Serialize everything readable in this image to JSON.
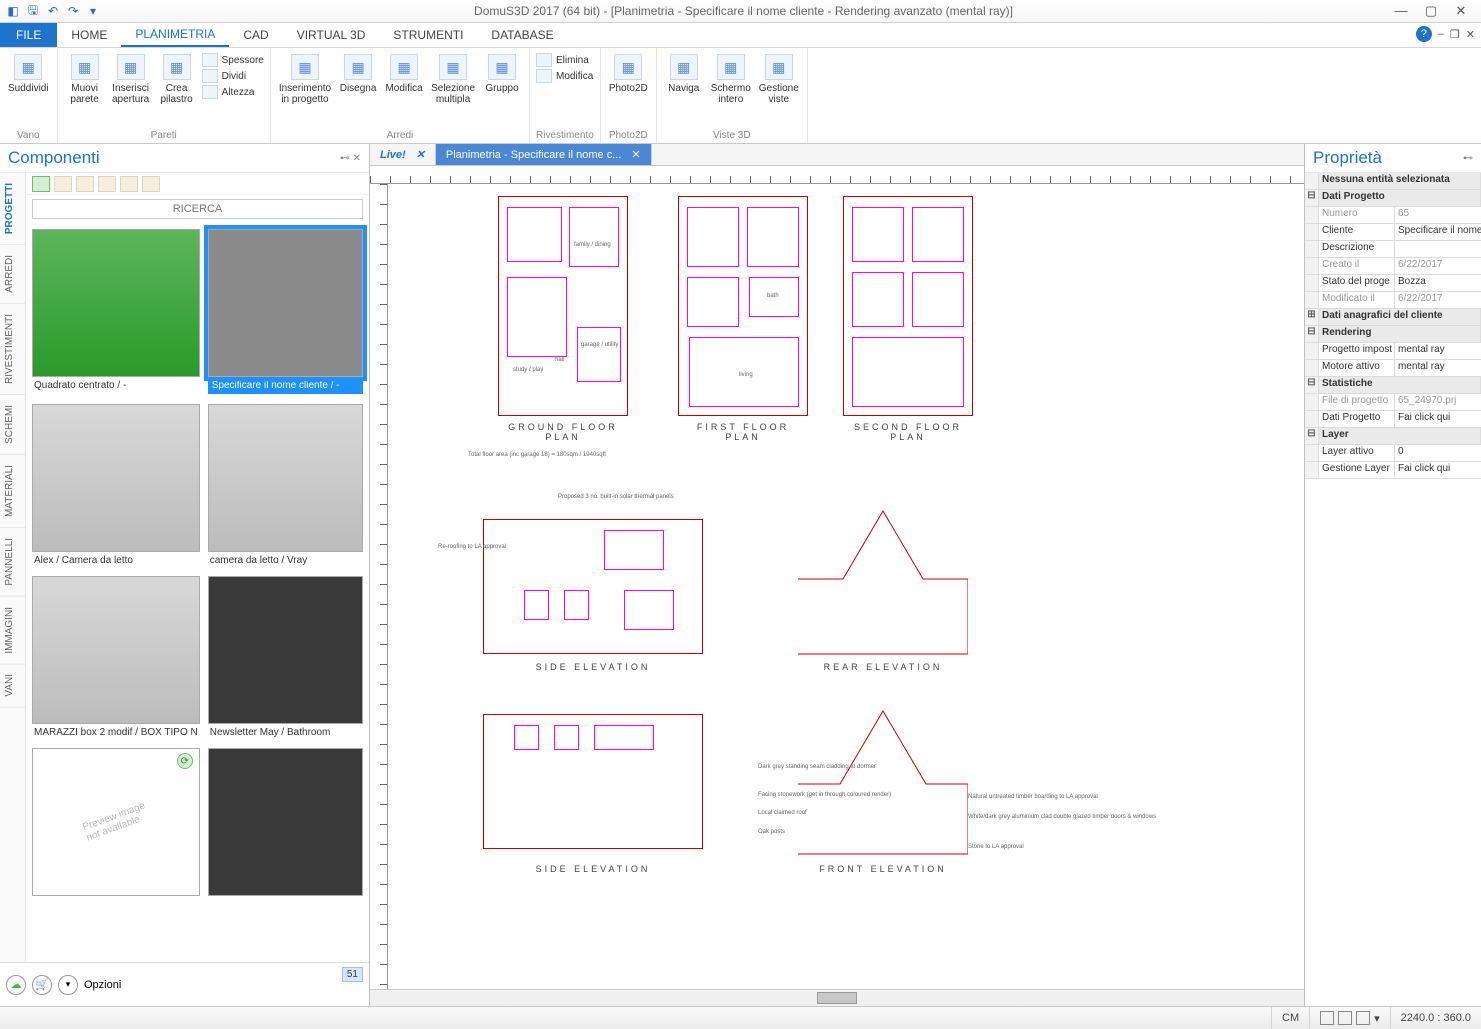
{
  "title": "DomuS3D 2017 (64 bit) - [Planimetria - Specificare il nome cliente - Rendering avanzato (mental ray)]",
  "menu": {
    "file": "FILE",
    "tabs": [
      "HOME",
      "PLANIMETRIA",
      "CAD",
      "VIRTUAL 3D",
      "STRUMENTI",
      "DATABASE"
    ],
    "active": 1
  },
  "ribbon": {
    "groups": [
      {
        "label": "Vano",
        "items": [
          {
            "label": "Suddividi"
          }
        ]
      },
      {
        "label": "Pareti",
        "items": [
          {
            "label": "Muovi\nparete"
          },
          {
            "label": "Inserisci\napertura"
          },
          {
            "label": "Crea\npilastro"
          }
        ],
        "stack": [
          "Spessore",
          "Dividi",
          "Altezza"
        ]
      },
      {
        "label": "Arredi",
        "items": [
          {
            "label": "Inserimento\nin progetto"
          },
          {
            "label": "Disegna"
          },
          {
            "label": "Modifica"
          },
          {
            "label": "Selezione\nmultipla"
          },
          {
            "label": "Gruppo"
          }
        ]
      },
      {
        "label": "Rivestimento",
        "items": [],
        "stack": [
          "Elimina",
          "Modifica"
        ]
      },
      {
        "label": "Photo2D",
        "items": [
          {
            "label": "Photo2D"
          }
        ]
      },
      {
        "label": "Viste 3D",
        "items": [
          {
            "label": "Naviga"
          },
          {
            "label": "Schermo\nintero"
          },
          {
            "label": "Gestione\nviste"
          }
        ]
      }
    ]
  },
  "componenti": {
    "title": "Componenti",
    "search_placeholder": "RICERCA",
    "vtabs": [
      "PROGETTI",
      "ARREDI",
      "RIVESTIMENTI",
      "SCHEMI",
      "MATERIALI",
      "PANNELLI",
      "IMMAGINI",
      "VANI"
    ],
    "vtab_active": 0,
    "thumbs": [
      {
        "cap": "Quadrato centrato / -",
        "cls": "green"
      },
      {
        "cap": "Specificare il nome cliente / -",
        "cls": "gray",
        "selected": true
      },
      {
        "cap": "Alex / Camera da letto",
        "cls": "room"
      },
      {
        "cap": "camera da letto / Vray",
        "cls": "room"
      },
      {
        "cap": "MARAZZI box 2 modif / BOX TIPO N",
        "cls": "room"
      },
      {
        "cap": "Newsletter May / Bathroom",
        "cls": "dark"
      },
      {
        "cap": "",
        "cls": "noprev",
        "noprev": true
      },
      {
        "cap": "",
        "cls": "dark"
      }
    ],
    "counter": "51",
    "opzioni": "Opzioni"
  },
  "doctabs": {
    "live": "Live!",
    "active": "Planimetria - Specificare il nome c..."
  },
  "canvas_labels": {
    "ground": "GROUND FLOOR PLAN",
    "first": "FIRST FLOOR PLAN",
    "second": "SECOND FLOOR PLAN",
    "side1": "SIDE ELEVATION",
    "rear": "REAR ELEVATION",
    "side2": "SIDE ELEVATION",
    "front": "FRONT ELEVATION",
    "note_area": "Total floor area (inc garage 18) = 180sqm / 1940sqft",
    "note_panels": "Proposed 3 no. built-in solar thermal panels",
    "note_roofing": "Re-roofing to LA approval",
    "note_cladding": "Dark grey standing seam cladding to dormer",
    "note_facing": "Facing stonework (get in through coloured render)",
    "note_reclaimed": "Local claimed roof",
    "note_oak": "Oak posts",
    "note_timber": "Natural untreated timber boarding to LA approval",
    "note_aluminium": "White/dark grey aluminium clad double glazed timber doors & windows",
    "note_stone": "Stone to LA approval",
    "rooms": {
      "family": "family /\ndining",
      "garage": "garage /\nutility",
      "hall": "hall",
      "study": "study /\nplay",
      "bath": "bath",
      "living": "living"
    }
  },
  "proprieta": {
    "title": "Proprietà",
    "header": "Nessuna entità selezionata",
    "rows": [
      {
        "type": "group",
        "k": "Dati Progetto"
      },
      {
        "type": "kv",
        "k": "Numero",
        "v": "65",
        "disabled": true
      },
      {
        "type": "kv",
        "k": "Cliente",
        "v": "Specificare il nome"
      },
      {
        "type": "kv",
        "k": "Descrizione",
        "v": ""
      },
      {
        "type": "kv",
        "k": "Creato il",
        "v": "6/22/2017",
        "disabled": true
      },
      {
        "type": "kv",
        "k": "Stato del proge",
        "v": "Bozza"
      },
      {
        "type": "kv",
        "k": "Modificato il",
        "v": "6/22/2017",
        "disabled": true
      },
      {
        "type": "group",
        "k": "Dati anagrafici del cliente",
        "plus": true
      },
      {
        "type": "group",
        "k": "Rendering"
      },
      {
        "type": "kv",
        "k": "Progetto impost",
        "v": "mental ray"
      },
      {
        "type": "kv",
        "k": "Motore attivo",
        "v": "mental ray"
      },
      {
        "type": "group",
        "k": "Statistiche"
      },
      {
        "type": "kv",
        "k": "File di progetto",
        "v": "65_24970.prj",
        "disabled": true
      },
      {
        "type": "kv",
        "k": "Dati Progetto",
        "v": "Fai click qui"
      },
      {
        "type": "group",
        "k": "Layer"
      },
      {
        "type": "kv",
        "k": "Layer attivo",
        "v": "0"
      },
      {
        "type": "kv",
        "k": "Gestione Layer",
        "v": "Fai click qui"
      }
    ]
  },
  "statusbar": {
    "unit": "CM",
    "coords": "2240.0 : 360.0"
  }
}
